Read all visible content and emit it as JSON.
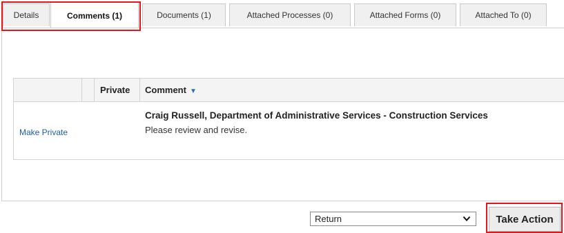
{
  "tabs": [
    {
      "label": "Details"
    },
    {
      "label": "Comments (1)",
      "active": true
    },
    {
      "label": "Documents (1)"
    },
    {
      "label": "Attached Processes (0)"
    },
    {
      "label": "Attached Forms (0)"
    },
    {
      "label": "Attached To (0)"
    }
  ],
  "grid": {
    "columns": {
      "private": "Private",
      "comment": "Comment"
    },
    "sort_icon": "caret-down-icon",
    "rows": [
      {
        "action_link": "Make Private",
        "author": "Craig Russell, Department of Administrative Services - Construction Services",
        "text": "Please review and revise."
      }
    ]
  },
  "action_bar": {
    "select_value": "Return",
    "button_label": "Take Action"
  },
  "colors": {
    "highlight": "#e8141b",
    "link": "#1d5fa8",
    "sort_caret": "#1a73c7"
  }
}
